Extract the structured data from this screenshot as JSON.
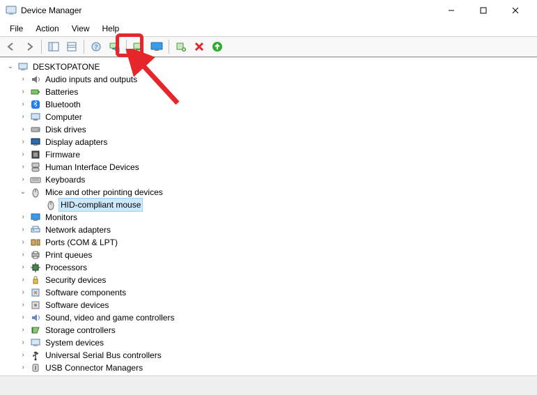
{
  "window": {
    "title": "Device Manager"
  },
  "menubar": [
    "File",
    "Action",
    "View",
    "Help"
  ],
  "toolbar_names": [
    "back",
    "forward",
    "show-all",
    "console-tree",
    "help",
    "scan-hardware",
    "update-driver",
    "uninstall",
    "disable",
    "enable"
  ],
  "tree": {
    "root": {
      "label": "DESKTOPATONE",
      "expanded": true
    },
    "categories": [
      {
        "label": "Audio inputs and outputs",
        "icon": "audio"
      },
      {
        "label": "Batteries",
        "icon": "battery"
      },
      {
        "label": "Bluetooth",
        "icon": "bluetooth"
      },
      {
        "label": "Computer",
        "icon": "computer"
      },
      {
        "label": "Disk drives",
        "icon": "disk"
      },
      {
        "label": "Display adapters",
        "icon": "display"
      },
      {
        "label": "Firmware",
        "icon": "firmware"
      },
      {
        "label": "Human Interface Devices",
        "icon": "hid"
      },
      {
        "label": "Keyboards",
        "icon": "keyboard"
      },
      {
        "label": "Mice and other pointing devices",
        "icon": "mouse",
        "expanded": true,
        "children": [
          {
            "label": "HID-compliant mouse",
            "icon": "mouse",
            "selected": true
          }
        ]
      },
      {
        "label": "Monitors",
        "icon": "monitor"
      },
      {
        "label": "Network adapters",
        "icon": "network"
      },
      {
        "label": "Ports (COM & LPT)",
        "icon": "ports"
      },
      {
        "label": "Print queues",
        "icon": "print"
      },
      {
        "label": "Processors",
        "icon": "cpu"
      },
      {
        "label": "Security devices",
        "icon": "security"
      },
      {
        "label": "Software components",
        "icon": "swcomp"
      },
      {
        "label": "Software devices",
        "icon": "swdev"
      },
      {
        "label": "Sound, video and game controllers",
        "icon": "sound"
      },
      {
        "label": "Storage controllers",
        "icon": "storage"
      },
      {
        "label": "System devices",
        "icon": "system"
      },
      {
        "label": "Universal Serial Bus controllers",
        "icon": "usb"
      },
      {
        "label": "USB Connector Managers",
        "icon": "usbconn"
      }
    ]
  },
  "annotation": {
    "highlighted_toolbar_button": "update-driver"
  }
}
